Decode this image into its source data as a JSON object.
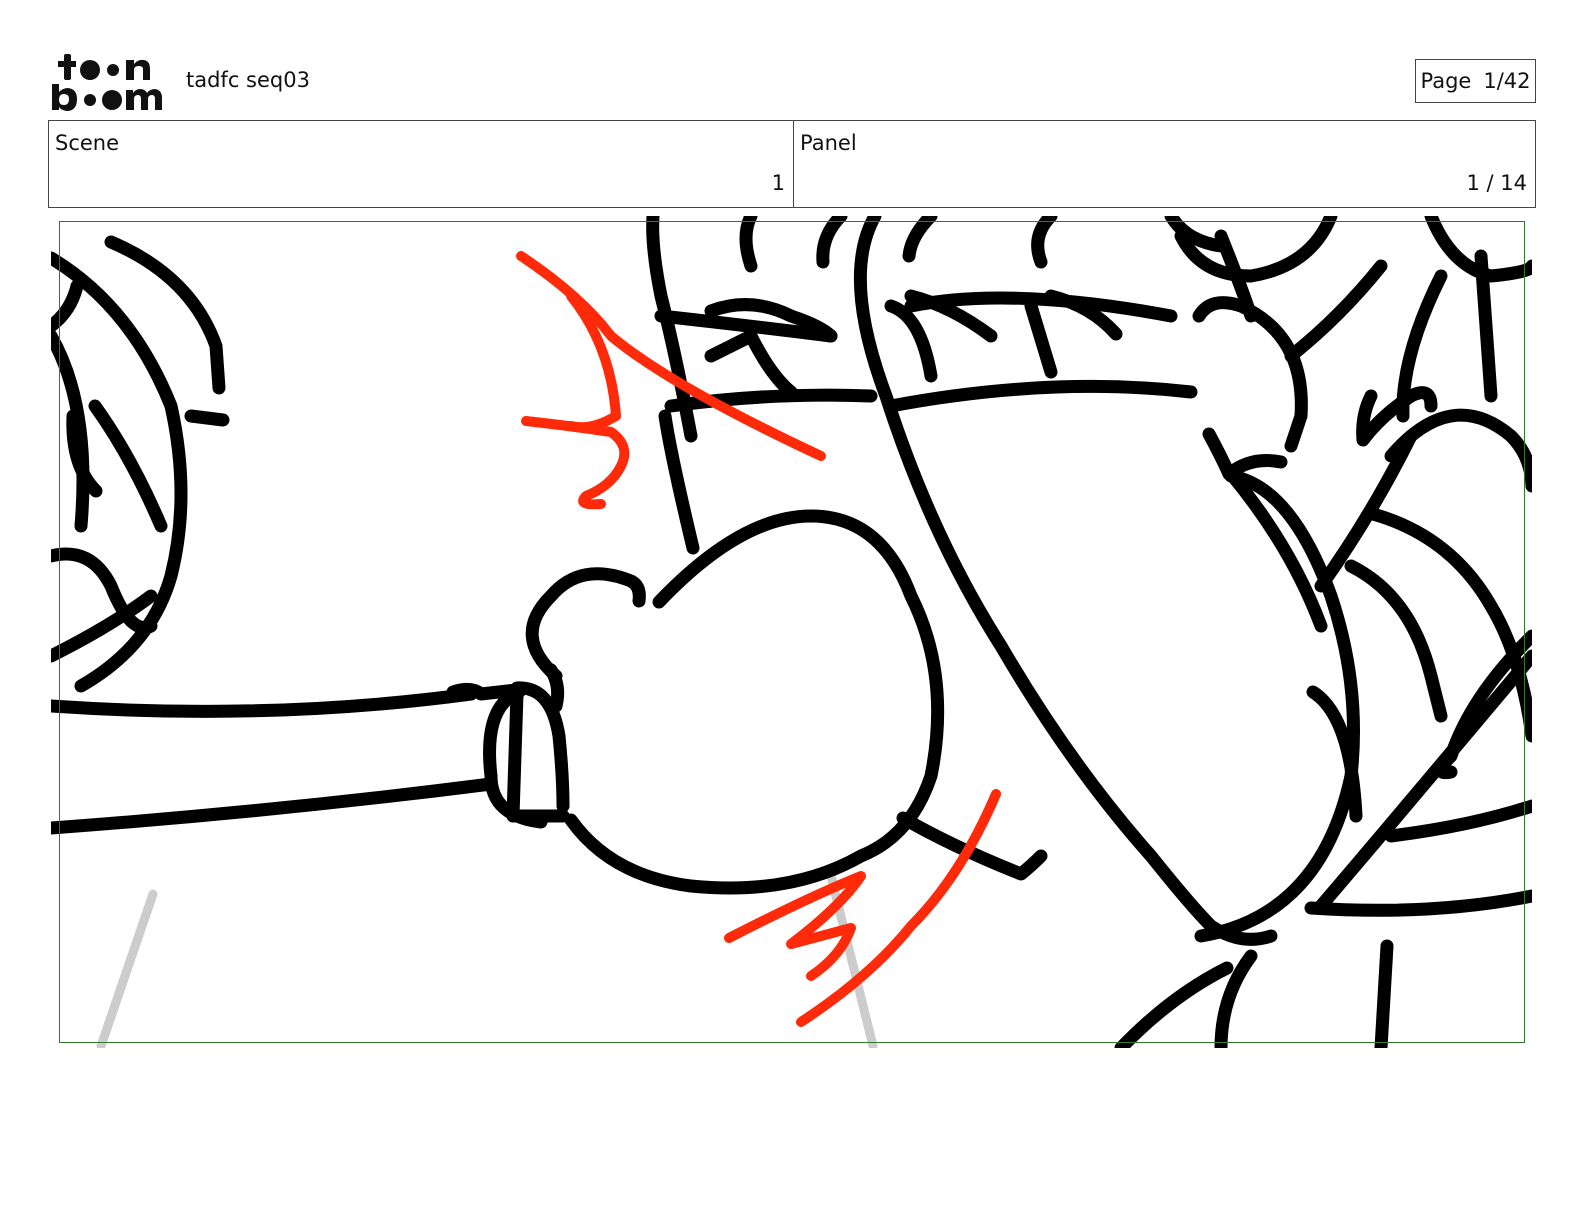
{
  "header": {
    "logo_text": "toon boom",
    "project_title": "tadfc seq03",
    "page_label": "Page",
    "page_value": "1/42"
  },
  "info": {
    "scene_label": "Scene",
    "scene_value": "1",
    "panel_label": "Panel",
    "panel_value": "1 / 14"
  },
  "colors": {
    "frame_border": "#2f7a2f",
    "ink": "#000000",
    "accent_red": "#ff2a0a",
    "guide_gray": "#cccccc"
  }
}
